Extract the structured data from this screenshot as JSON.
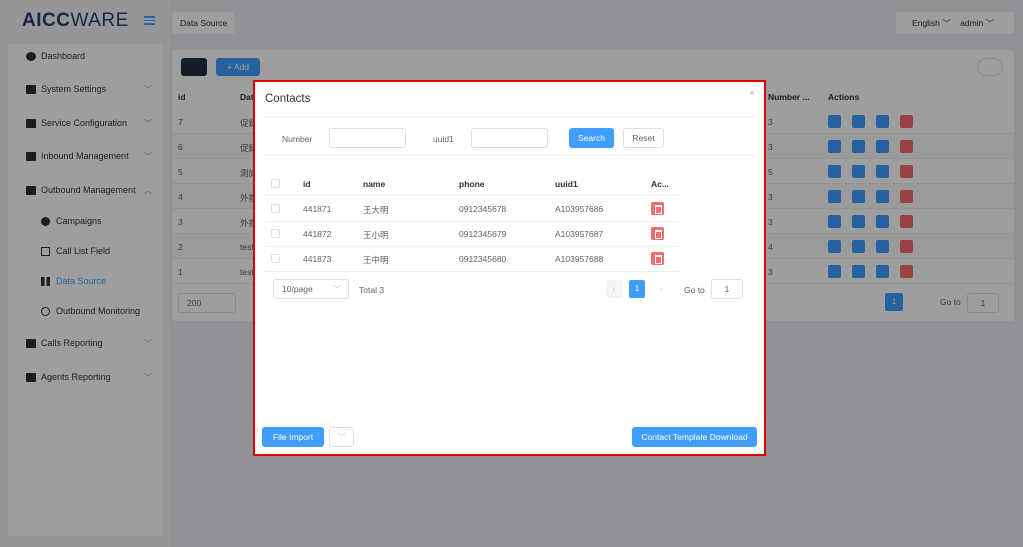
{
  "app": {
    "logo_main": "AICC",
    "logo_sub": "WARE",
    "breadcrumb": "Data Source",
    "language": "English",
    "user": "admin"
  },
  "sidebar": {
    "items": [
      {
        "label": "Dashboard",
        "icon": "dashboard-icon"
      },
      {
        "label": "System Settings",
        "icon": "users-icon"
      },
      {
        "label": "Service Configuration",
        "icon": "id-card-icon"
      },
      {
        "label": "Inbound Management",
        "icon": "list-icon"
      },
      {
        "label": "Outbound Management",
        "icon": "th-list-icon"
      },
      {
        "label": "Calls Reporting",
        "icon": "bar-chart-icon"
      },
      {
        "label": "Agents Reporting",
        "icon": "line-chart-icon"
      }
    ],
    "outbound_sub": [
      "Campaigns",
      "Call List Field",
      "Data Source",
      "Outbound Monitoring"
    ]
  },
  "background_table": {
    "add_label": "+ Add",
    "headers": [
      "id",
      "Dat",
      "Number ...",
      "Actions"
    ],
    "rows": [
      {
        "id": "7",
        "name": "促銷",
        "number": "3"
      },
      {
        "id": "6",
        "name": "促銷",
        "number": "3"
      },
      {
        "id": "5",
        "name": "測試",
        "number": "5"
      },
      {
        "id": "4",
        "name": "外撥",
        "number": "3"
      },
      {
        "id": "3",
        "name": "外撥",
        "number": "3"
      },
      {
        "id": "2",
        "name": "test",
        "number": "4"
      },
      {
        "id": "1",
        "name": "test",
        "number": "3"
      }
    ],
    "page_size": "200",
    "current_page": "1",
    "goto_label": "Go to",
    "goto_value": "1"
  },
  "modal": {
    "title": "Contacts",
    "close": "×",
    "filter": {
      "number_label": "Number",
      "number_value": "",
      "uuid1_label": "uuid1",
      "uuid1_value": "",
      "search": "Search",
      "reset": "Reset"
    },
    "headers": [
      "id",
      "name",
      "phone",
      "uuid1",
      "Ac..."
    ],
    "rows": [
      {
        "id": "441871",
        "name": "王大明",
        "phone": "0912345678",
        "uuid1": "A103957686"
      },
      {
        "id": "441872",
        "name": "王小明",
        "phone": "0912345679",
        "uuid1": "A103957687"
      },
      {
        "id": "441873",
        "name": "王中明",
        "phone": "0912345680",
        "uuid1": "A103957688"
      }
    ],
    "pagination": {
      "page_size": "10/page",
      "total": "Total 3",
      "current": "1",
      "goto_label": "Go to",
      "goto_value": "1"
    },
    "file_import": "File Import",
    "template_download": "Contact Template Download"
  },
  "colors": {
    "primary": "#409eff",
    "danger": "#f56c6c",
    "highlight_border": "#e00000",
    "logo": "#2b3f6c"
  }
}
